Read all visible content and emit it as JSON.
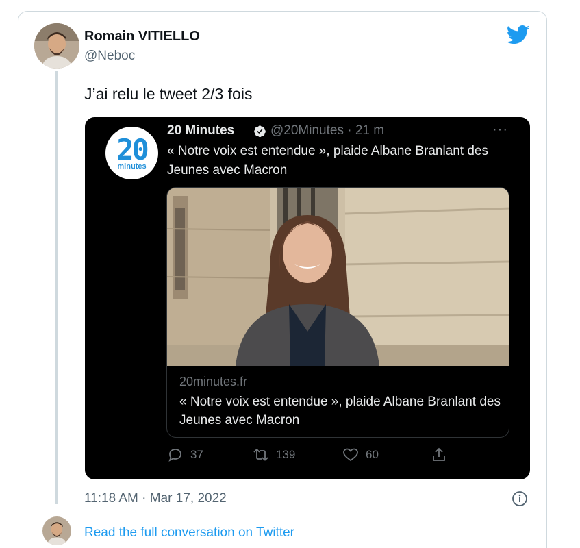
{
  "tweet": {
    "author_name": "Romain VITIELLO",
    "author_handle": "@Neboc",
    "text": "J’ai relu le tweet 2/3 fois",
    "timestamp": "11:18 AM · Mar 17, 2022",
    "read_more": "Read the full conversation on Twitter"
  },
  "embedded": {
    "avatar_number": "20",
    "avatar_label": "minutes",
    "name": "20 Minutes",
    "meta": "@20Minutes · 21 m",
    "more": "···",
    "text": "« Notre voix est entendue », plaide Albane Branlant des Jeunes avec Macron",
    "link_domain": "20minutes.fr",
    "link_title": "« Notre voix est entendue », plaide Albane Branlant des Jeunes avec Macron",
    "replies": "37",
    "retweets": "139",
    "likes": "60"
  },
  "icons": [
    "twitter-bird-icon",
    "verified-badge-icon",
    "more-icon",
    "reply-icon",
    "retweet-icon",
    "like-icon",
    "share-icon",
    "info-icon"
  ],
  "colors": {
    "twitter_blue": "#1d9bf0",
    "embed_bg": "#000000",
    "muted": "#536471"
  }
}
